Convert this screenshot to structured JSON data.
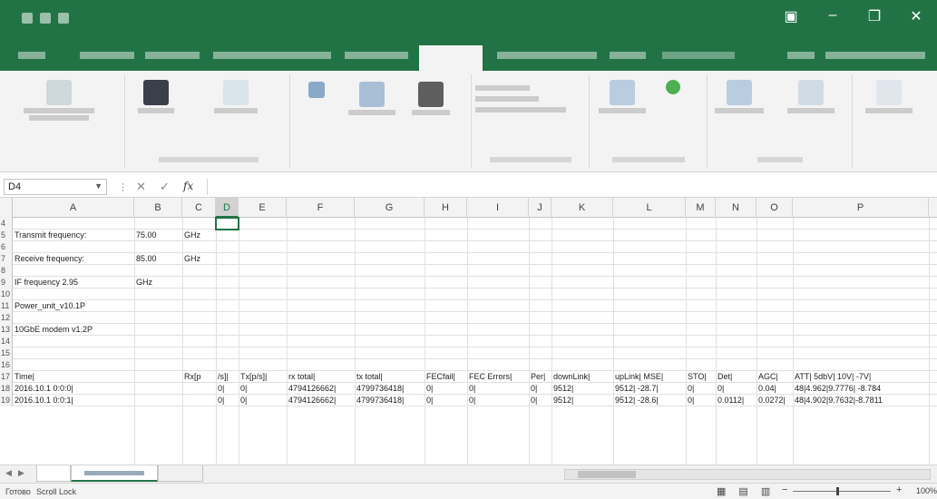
{
  "app": {
    "accent": "#217346"
  },
  "window_controls": {
    "minimize": "–",
    "restore": "❐",
    "close": "✕"
  },
  "formula_bar": {
    "name_box": "D4",
    "cancel": "✕",
    "enter": "✓",
    "fx": "fx",
    "formula": ""
  },
  "columns": [
    "A",
    "B",
    "C",
    "D",
    "E",
    "F",
    "G",
    "H",
    "I",
    "J",
    "K",
    "L",
    "M",
    "N",
    "O",
    "P"
  ],
  "rows": [
    {
      "n": "4",
      "cells": []
    },
    {
      "n": "5",
      "cells": [
        {
          "col": "A",
          "v": "Transmit frequency:"
        },
        {
          "col": "B",
          "v": "75.00"
        },
        {
          "col": "C",
          "v": "GHz"
        }
      ]
    },
    {
      "n": "6",
      "cells": []
    },
    {
      "n": "7",
      "cells": [
        {
          "col": "A",
          "v": "Receive frequency:"
        },
        {
          "col": "B",
          "v": "85.00"
        },
        {
          "col": "C",
          "v": "GHz"
        }
      ]
    },
    {
      "n": "8",
      "cells": []
    },
    {
      "n": "9",
      "cells": [
        {
          "col": "A",
          "v": "IF frequency  2.95"
        },
        {
          "col": "B",
          "v": "GHz"
        }
      ]
    },
    {
      "n": "10",
      "cells": []
    },
    {
      "n": "11",
      "cells": [
        {
          "col": "A",
          "v": "Power_unit_v10.1P"
        }
      ]
    },
    {
      "n": "12",
      "cells": []
    },
    {
      "n": "13",
      "cells": [
        {
          "col": "A",
          "v": "10GbE modem v1.2P"
        }
      ]
    },
    {
      "n": "14",
      "cells": []
    },
    {
      "n": "15",
      "cells": []
    },
    {
      "n": "16",
      "cells": []
    },
    {
      "n": "17",
      "cells": [
        {
          "col": "A",
          "v": "Time|"
        },
        {
          "col": "C",
          "v": "Rx[p"
        },
        {
          "col": "D",
          "v": "/s]|"
        },
        {
          "col": "E",
          "v": "Tx[p/s]|"
        },
        {
          "col": "F",
          "v": "rx total|"
        },
        {
          "col": "G",
          "v": "tx total|"
        },
        {
          "col": "H",
          "v": "FECfail|"
        },
        {
          "col": "I",
          "v": "FEC Errors|"
        },
        {
          "col": "J",
          "v": "Per|"
        },
        {
          "col": "K",
          "v": "downLink|"
        },
        {
          "col": "L",
          "v": "upLink|  MSE|"
        },
        {
          "col": "M",
          "v": "STO|"
        },
        {
          "col": "N",
          "v": "Det|"
        },
        {
          "col": "O",
          "v": "AGC|"
        },
        {
          "col": "P",
          "v": "ATT| 5dbV|  10V|   -7V|"
        }
      ]
    },
    {
      "n": "18",
      "cells": [
        {
          "col": "A",
          "v": "2016.10.1 0:0:0|"
        },
        {
          "col": "D",
          "v": "0|"
        },
        {
          "col": "E",
          "v": "0|"
        },
        {
          "col": "F",
          "v": "4794126662|"
        },
        {
          "col": "G",
          "v": "4799736418|"
        },
        {
          "col": "H",
          "v": "0|"
        },
        {
          "col": "I",
          "v": "0|"
        },
        {
          "col": "J",
          "v": "0|"
        },
        {
          "col": "K",
          "v": "9512|"
        },
        {
          "col": "L",
          "v": "9512| -28.7|"
        },
        {
          "col": "M",
          "v": "0|"
        },
        {
          "col": "N",
          "v": "0|"
        },
        {
          "col": "O",
          "v": "0.04|"
        },
        {
          "col": "P",
          "v": "48|4.962|9.7776|  -8.784"
        }
      ]
    },
    {
      "n": "19",
      "cells": [
        {
          "col": "A",
          "v": "2016.10.1 0:0:1|"
        },
        {
          "col": "D",
          "v": "0|"
        },
        {
          "col": "E",
          "v": "0|"
        },
        {
          "col": "F",
          "v": "4794126662|"
        },
        {
          "col": "G",
          "v": "4799736418|"
        },
        {
          "col": "H",
          "v": "0|"
        },
        {
          "col": "I",
          "v": "0|"
        },
        {
          "col": "J",
          "v": "0|"
        },
        {
          "col": "K",
          "v": "9512|"
        },
        {
          "col": "L",
          "v": "9512| -28.6|"
        },
        {
          "col": "M",
          "v": "0|"
        },
        {
          "col": "N",
          "v": "0.0112|"
        },
        {
          "col": "O",
          "v": "0.0272|"
        },
        {
          "col": "P",
          "v": "48|4.902|9.7632|-8.7811"
        }
      ]
    }
  ],
  "status": {
    "left": "Готово",
    "mode": "Scroll Lock",
    "zoom": "100%"
  }
}
